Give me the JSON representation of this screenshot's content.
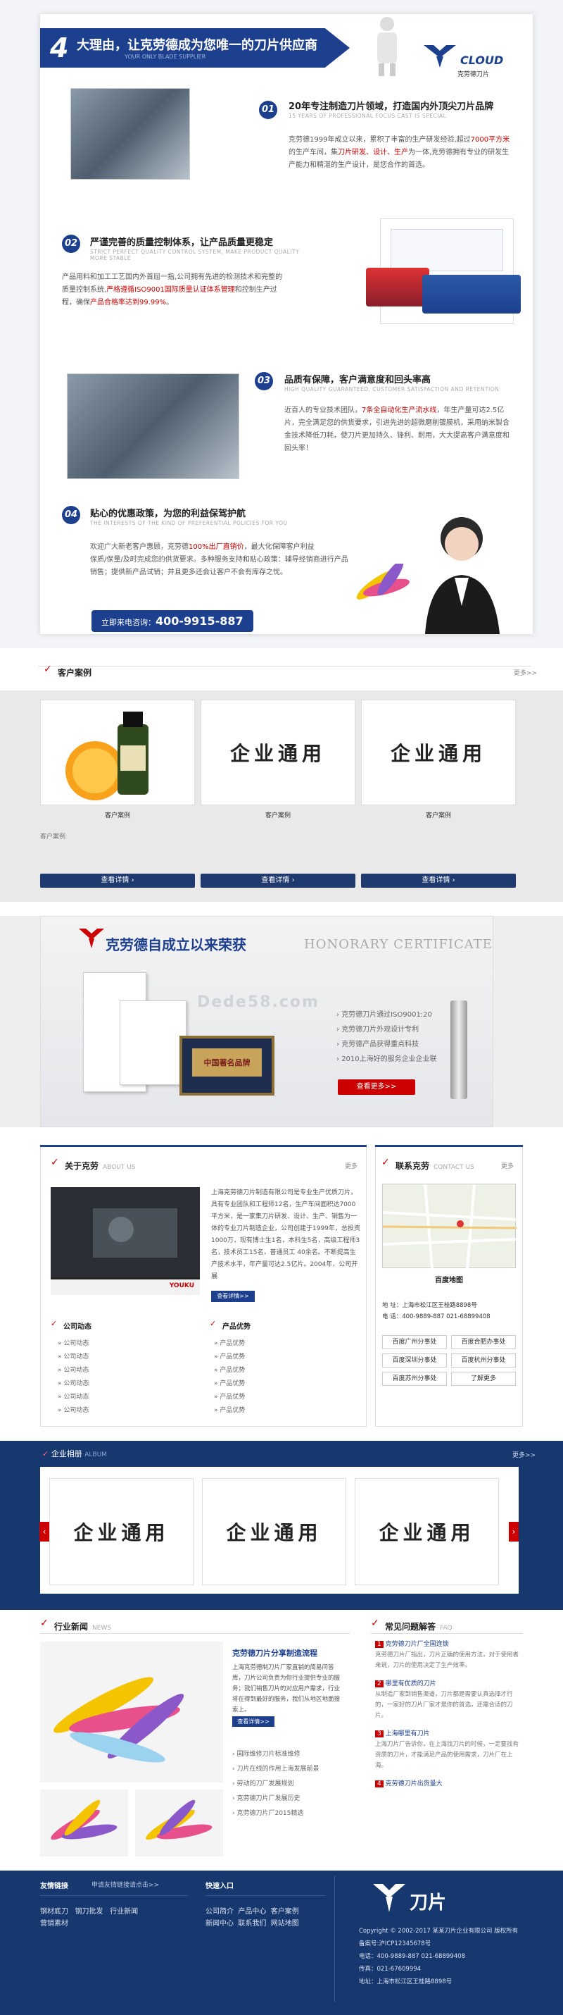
{
  "reasons": {
    "banner_num": "4",
    "banner_title": "大理由，让克劳德成为您唯一的刀片供应商",
    "banner_sub": "YOUR ONLY BLADE SUPPLIER",
    "brand_en": "CLOUD",
    "brand_cn": "克劳德刀片",
    "items": [
      {
        "num": "01",
        "title": "20年专注制造刀片领域，打造国内外顶尖刀片品牌",
        "en": "15 YEARS OF PROFESSIONAL FOCUS CAST IS SPECIAL",
        "p1": "克劳德1999年成立以来，累积了丰富的生产研发经验,超过",
        "p1_red": "7000平方米",
        "p2": "的生产车间，集",
        "p2_red": "刀片研发、设计、生产",
        "p3": "为一体,克劳德拥有专业的研发生产能力和精湛的生产设计，是您合作的首选。"
      },
      {
        "num": "02",
        "title": "严谨完善的质量控制体系，让产品质量更稳定",
        "en": "STRICT PERFECT QUALITY CONTROL SYSTEM, MAKE PRODUCT QUALITY MORE STABLE",
        "p1": "产品用料和加工工艺国内外首屈一指,公司拥有先进的检测技术和完整的质量控制系统,",
        "p1_red": "严格遵循ISO9001国际质量认证体系管理",
        "p2": "和控制生产过程，确保",
        "p2_red": "产品合格率达到99.99%",
        "p3": "。"
      },
      {
        "num": "03",
        "title": "品质有保障，客户满意度和回头率高",
        "en": "HIGH QUALITY GUARANTEED, CUSTOMER SATISFACTION AND RETENTION",
        "p1": "近百人的专业技术团队，",
        "p1_red": "7条全自动化生产流水线",
        "p2": "，年生产量可达2.5亿片，完全满足您的供货要求，引进先进的超微磨削镀膜机，采用纳米製合金技术降低刀耗，使刀片更加持久、锋利、耐用，大大提高客户满意度和回头率！",
        "p2_red": "",
        "p3": ""
      },
      {
        "num": "04",
        "title": "贴心的优惠政策，为您的利益保驾护航",
        "en": "THE INTERESTS OF THE KIND OF PREFERENTIAL POLICIES FOR YOU",
        "p1": "欢迎广大新老客户惠顾，克劳德",
        "p1_red": "100%出厂直销价",
        "p2": "，最大化保障客户利益",
        "p2_red": "",
        "p3": "保质/保量/及时完成您的供货要求。多种服务支持和贴心政策：辅导经销商进行产品销售；提供新产品试销；并且更多还会让客户不会有库存之忧。"
      }
    ],
    "cta_label": "立即来电咨询：",
    "cta_phone": "400-9915-887"
  },
  "cases": {
    "title": "客户案例",
    "more": "更多>>",
    "tiles": [
      {
        "caption": "客户案例",
        "text": "",
        "kind": "photo"
      },
      {
        "caption": "客户案例",
        "text": "企业通用",
        "kind": "text"
      },
      {
        "caption": "客户案例",
        "text": "企业通用",
        "kind": "text"
      }
    ],
    "desc": "客户案例",
    "btn": "查看详情"
  },
  "honor": {
    "title": "克劳德自成立以来荣获",
    "en": "HONORARY CERTIFICATE",
    "watermark": "Dede58.com",
    "cert_label": "中国著名品牌",
    "list": [
      "克劳德刀片通过ISO9001:20",
      "克劳德刀片外观设计专利",
      "克劳德产品获得重点科技",
      "2010上海好的服务企业企业联"
    ],
    "btn": "查看更多>>"
  },
  "about": {
    "title": "关于克劳",
    "en": "ABOUT US",
    "more": "更多",
    "text": "上海克劳德刀片制造有限公司是专业生产优质刀片，具有专业团队和工程师12名，生产车间面积达7000平方米，是一家集刀片研发、设计、生产、销售为一体的专业刀片制造企业，公司创建于1999年，总投资1000万，现有博士生1名，本科生5名，高级工程师3名，技术员工15名，普通员工 40余名。不断提高生产技术水平，年产量可达2.5亿片。2004年，公司开展",
    "video_brand": "YOUKU",
    "btn": "查看详情>>",
    "news_title": "公司动态",
    "news": [
      "公司动态",
      "公司动态",
      "公司动态",
      "公司动态",
      "公司动态",
      "公司动态"
    ],
    "prod_title": "产品优势",
    "prods": [
      "产品优势",
      "产品优势",
      "产品优势",
      "产品优势",
      "产品优势",
      "产品优势"
    ]
  },
  "contact": {
    "title": "联系克劳",
    "en": "CONTACT US",
    "more": "更多",
    "map_label": "百度地图",
    "addr": "地 址：上海市松江区王桂路8898号",
    "tel": "电 话：400-9889-887 021-68899408",
    "buttons": [
      "百度广州分事处",
      "百度合肥办事处",
      "百度深圳分事处",
      "百度杭州分事处",
      "百度苏州分事处",
      "了解更多"
    ]
  },
  "album": {
    "title": "企业相册",
    "en": "ALBUM",
    "more": "更多>>",
    "tiles": [
      "企业通用",
      "企业通用",
      "企业通用"
    ]
  },
  "news": {
    "title": "行业新闻",
    "en": "NEWS",
    "feature_title": "克劳德刀片分享制造流程",
    "feature_text": "上海克劳德制刀片厂家直销的简易问答库，刀片公司负责为你行业提供专业的服务；我们销售刀片的对应用户需求，行业将在得到最好的服务，我们从地区地面搜索上。",
    "btn": "查看详情>>",
    "list": [
      "国际维修刀片标准维修",
      "刀片在线的作用上海发展前景",
      "劳动的刀厂发展规划",
      "克劳德刀片厂发展历史",
      "克劳德刀片厂2015精选"
    ]
  },
  "faq": {
    "title": "常见问题解答",
    "en": "FAQ",
    "items": [
      {
        "q": "克劳德刀片厂全国连锁",
        "a": "克劳德刀片厂指出，刀片正确的使用方法，对于使用者来说，刀片的使用决定了生产效率。"
      },
      {
        "q": "哪里有优质的刀片",
        "a": "从制造厂家到销售渠道，刀片都是需要认真选择才行的，一家好的刀片厂家才是你的首选，还需合适的刀片。"
      },
      {
        "q": "上海哪里有刀片",
        "a": "上海刀片厂告诉你，在上海找刀片的时候，一定要找有资质的刀片，才能满足产品的使用需求，刀片厂在上海。"
      },
      {
        "q": "克劳德刀片出货量大",
        "a": ""
      }
    ]
  },
  "footer": {
    "links_title": "友情链接",
    "links_sub": "申请友情链接请点击>>",
    "links": [
      "钢材底刀",
      "钢刀批发",
      "行业新闻",
      "营销素材"
    ],
    "quick_title": "快速入口",
    "quick": [
      "公司简介",
      "产品中心",
      "客户案例",
      "新闻中心",
      "联系我们",
      "网站地图"
    ],
    "logo_cn": "刀片",
    "copyright": "Copyright © 2002-2017 某某刀片企业有限公司 版权所有",
    "icp": "备案号:沪ICP12345678号",
    "tel": "电话：400-9889-887  021-68899408",
    "fax": "传真：021-67609994",
    "addr": "地址：上海市松江区王桂路8898号"
  },
  "colors": {
    "primary": "#1c3f8e",
    "accent": "#c00000",
    "dark": "#1e3a6e"
  }
}
